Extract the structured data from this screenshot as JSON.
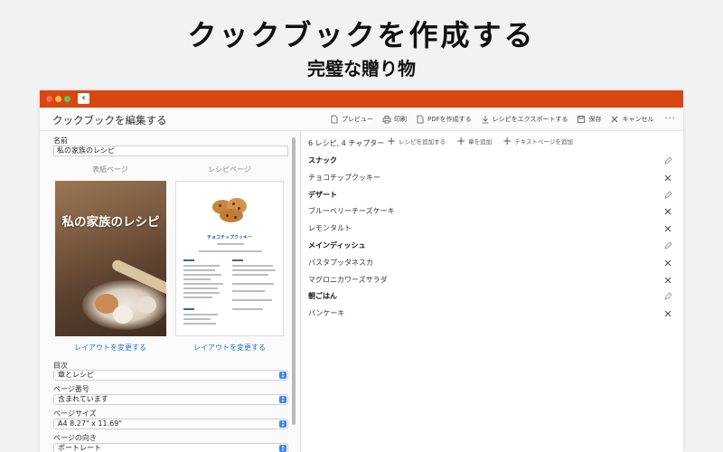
{
  "promo": {
    "headline": "クックブックを作成する",
    "subheadline": "完璧な贈り物"
  },
  "colors": {
    "titlebar": "#d8470f",
    "link": "#2a74c9",
    "accent": "#3b82f6"
  },
  "toolbar": {
    "title": "クックブックを編集する",
    "actions": [
      {
        "label": "プレビュー",
        "icon": "document-icon"
      },
      {
        "label": "印刷",
        "icon": "printer-icon"
      },
      {
        "label": "PDFを作成する",
        "icon": "pdf-icon"
      },
      {
        "label": "レシピをエクスポートする",
        "icon": "download-icon"
      },
      {
        "label": "保存",
        "icon": "save-icon"
      },
      {
        "label": "キャンセル",
        "icon": "close-icon"
      }
    ],
    "more": "···"
  },
  "editor": {
    "name_label": "名前",
    "name_value": "私の家族のレシピ",
    "cover_header": "表紙ページ",
    "recipe_header": "レシピページ",
    "cover_title": "私の家族のレシピ",
    "recipe_preview_title": "チョコチップクッキー",
    "change_layout": "レイアウトを変更する",
    "toc_label": "目次",
    "toc_value": "章とレシピ",
    "page_number_label": "ページ番号",
    "page_number_value": "含まれています",
    "page_size_label": "ページサイズ",
    "page_size_value": "A4 8.27\" x 11.69\"",
    "orientation_label": "ページの向き",
    "orientation_value": "ポートレート"
  },
  "contents": {
    "summary": "6 レシピ, 4 チャプター",
    "actions": [
      "レシピを追加する",
      "章を追加",
      "テキストページを追加"
    ],
    "rows": [
      {
        "label": "スナック",
        "type": "chapter"
      },
      {
        "label": "チョコチップクッキー",
        "type": "recipe"
      },
      {
        "label": "デザート",
        "type": "chapter"
      },
      {
        "label": "ブルーベリーチーズケーキ",
        "type": "recipe"
      },
      {
        "label": "レモンタルト",
        "type": "recipe"
      },
      {
        "label": "メインディッシュ",
        "type": "chapter"
      },
      {
        "label": "パスタプッタネスカ",
        "type": "recipe"
      },
      {
        "label": "マグロニカワーズサラダ",
        "type": "recipe"
      },
      {
        "label": "朝ごはん",
        "type": "chapter"
      },
      {
        "label": "パンケーキ",
        "type": "recipe"
      }
    ]
  }
}
